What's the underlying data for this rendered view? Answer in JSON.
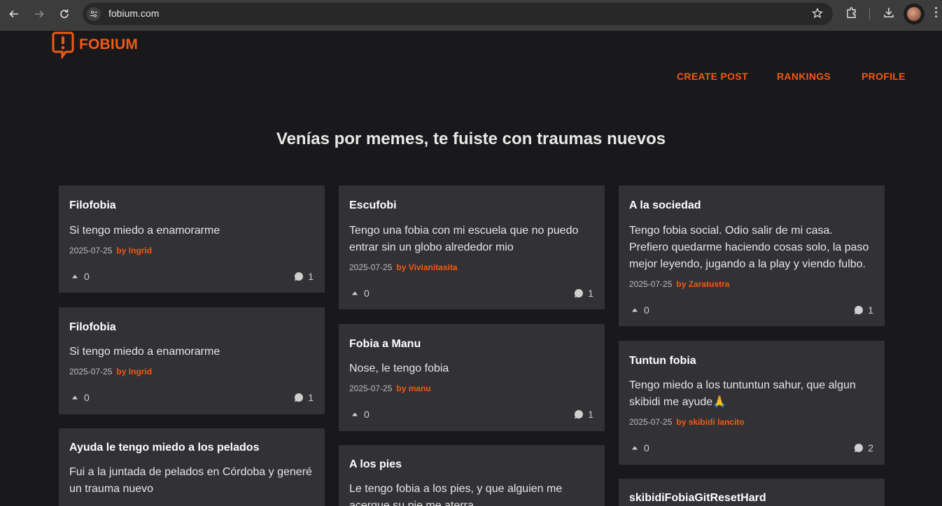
{
  "browser": {
    "url": "fobium.com",
    "icons": [
      "back-icon",
      "forward-icon",
      "reload-icon",
      "site-settings-icon",
      "bookmark-star-icon",
      "extensions-icon",
      "downloads-icon",
      "profile-avatar",
      "menu-icon"
    ]
  },
  "site": {
    "logo_text": "FOBIUM",
    "nav": {
      "create_post": "CREATE POST",
      "rankings": "RANKINGS",
      "profile": "PROFILE"
    },
    "tagline": "Venías por memes, te fuiste con traumas nuevos",
    "accent": "#f25a14"
  },
  "posts": [
    {
      "title": "Filofobia",
      "body": "Si tengo miedo a enamorarme",
      "date": "2025-07-25",
      "author": "by Ingrid",
      "votes": "0",
      "comments": "1"
    },
    {
      "title": "Escufobi",
      "body": "Tengo una fobia con mi escuela que no puedo entrar sin un globo alrededor mio",
      "date": "2025-07-25",
      "author": "by Vivianitasita",
      "votes": "0",
      "comments": "1"
    },
    {
      "title": "A la sociedad",
      "body": "Tengo fobia social. Odio salir de mi casa. Prefiero quedarme haciendo cosas solo, la paso mejor leyendo, jugando a la play y viendo fulbo.",
      "date": "2025-07-25",
      "author": "by Zaratustra",
      "votes": "0",
      "comments": "1"
    },
    {
      "title": "Filofobia",
      "body": "Si tengo miedo a enamorarme",
      "date": "2025-07-25",
      "author": "by Ingrid",
      "votes": "0",
      "comments": "1"
    },
    {
      "title": "Fobia a Manu",
      "body": "Nose, le tengo fobia",
      "date": "2025-07-25",
      "author": "by manu",
      "votes": "0",
      "comments": "1"
    },
    {
      "title": "Tuntun fobia",
      "body": "Tengo miedo a los tuntuntun sahur, que algun skibidi me ayude🙏",
      "date": "2025-07-25",
      "author": "by skibidi lancito",
      "votes": "0",
      "comments": "2"
    },
    {
      "title": "Ayuda le tengo miedo a los pelados",
      "body": "Fui a la juntada de pelados en Córdoba y generé un trauma nuevo"
    },
    {
      "title": "A los pies",
      "body": "Le tengo fobia a los pies, y que alguien me acerque su pie me aterra"
    },
    {
      "title": "skibidiFobiaGitResetHard"
    }
  ]
}
